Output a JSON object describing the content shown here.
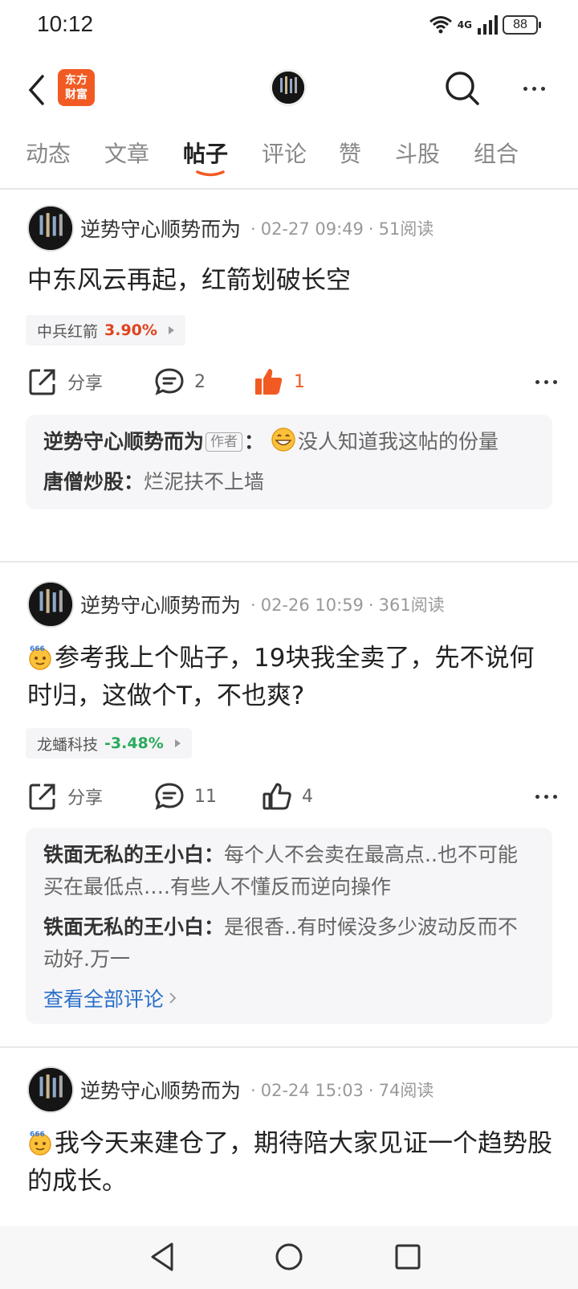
{
  "status_bar": {
    "time": "10:12",
    "network": "4G",
    "battery": "88"
  },
  "header": {
    "logo_text": "东方\n财富",
    "logo_line1": "东方",
    "logo_line2": "财富"
  },
  "tabs": [
    {
      "label": "动态",
      "active": false
    },
    {
      "label": "文章",
      "active": false
    },
    {
      "label": "帖子",
      "active": true
    },
    {
      "label": "评论",
      "active": false
    },
    {
      "label": "赞",
      "active": false
    },
    {
      "label": "斗股",
      "active": false
    },
    {
      "label": "组合",
      "active": false
    }
  ],
  "colors": {
    "brand": "#f15a22",
    "up": "#e0431e",
    "down": "#2bab5c",
    "link": "#2a6fc9"
  },
  "posts": [
    {
      "author": "逆势守心顺势而为",
      "date": "02-27 09:49",
      "reads": "51阅读",
      "title": "中东风云再起，红箭划破长空",
      "stock_name": "中兵红箭",
      "stock_change": "3.90%",
      "share_label": "分享",
      "comment_count": "2",
      "like_count": "1",
      "liked": true,
      "comments": [
        {
          "name": "逆势守心顺势而为",
          "badge": "作者",
          "sep": "：",
          "text": "没人知道我这帖的份量",
          "emoji": "grinning-face"
        },
        {
          "name": "唐僧炒股",
          "sep": "：",
          "text": "烂泥扶不上墙"
        }
      ]
    },
    {
      "author": "逆势守心顺势而为",
      "date": "02-26 10:59",
      "reads": "361阅读",
      "title": "参考我上个贴子，19块我全卖了，先不说何时归，这做个T，不也爽?",
      "title_emoji": "666-face",
      "stock_name": "龙蟠科技",
      "stock_change": "-3.48%",
      "share_label": "分享",
      "comment_count": "11",
      "like_count": "4",
      "liked": false,
      "comments": [
        {
          "name": "铁面无私的王小白",
          "sep": "：",
          "text": "每个人不会卖在最高点..也不可能买在最低点….有些人不懂反而逆向操作"
        },
        {
          "name": "铁面无私的王小白",
          "sep": "：",
          "text": "是很香..有时候没多少波动反而不动好.万一"
        }
      ],
      "view_all": "查看全部评论"
    },
    {
      "author": "逆势守心顺势而为",
      "date": "02-24 15:03",
      "reads": "74阅读",
      "title": "我今天来建仓了，期待陪大家见证一个趋势股的成长。",
      "title_emoji": "666-face"
    }
  ]
}
